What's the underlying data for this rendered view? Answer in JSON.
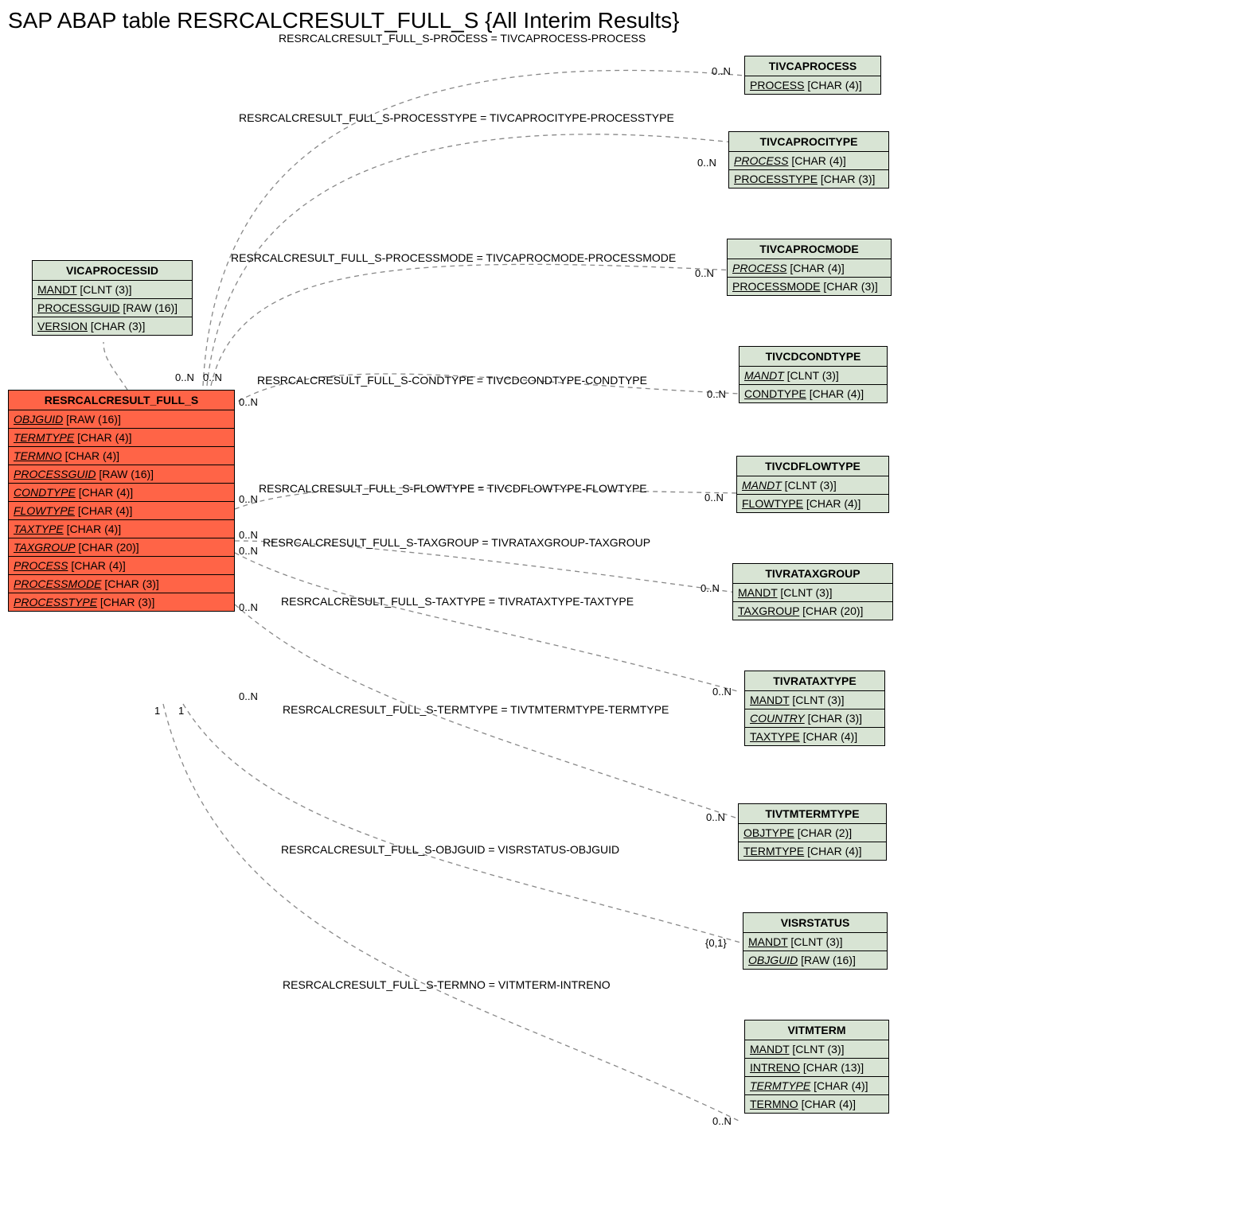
{
  "title": "SAP ABAP table RESRCALCRESULT_FULL_S {All Interim Results}",
  "entities": {
    "vicaprocessid": {
      "name": "VICAPROCESSID",
      "fields": [
        {
          "name": "MANDT",
          "type": "[CLNT (3)]",
          "italic": false
        },
        {
          "name": "PROCESSGUID",
          "type": "[RAW (16)]",
          "italic": false
        },
        {
          "name": "VERSION",
          "type": "[CHAR (3)]",
          "italic": false
        }
      ]
    },
    "main": {
      "name": "RESRCALCRESULT_FULL_S",
      "fields": [
        {
          "name": "OBJGUID",
          "type": "[RAW (16)]",
          "italic": true
        },
        {
          "name": "TERMTYPE",
          "type": "[CHAR (4)]",
          "italic": true
        },
        {
          "name": "TERMNO",
          "type": "[CHAR (4)]",
          "italic": true
        },
        {
          "name": "PROCESSGUID",
          "type": "[RAW (16)]",
          "italic": true
        },
        {
          "name": "CONDTYPE",
          "type": "[CHAR (4)]",
          "italic": true
        },
        {
          "name": "FLOWTYPE",
          "type": "[CHAR (4)]",
          "italic": true
        },
        {
          "name": "TAXTYPE",
          "type": "[CHAR (4)]",
          "italic": true
        },
        {
          "name": "TAXGROUP",
          "type": "[CHAR (20)]",
          "italic": true
        },
        {
          "name": "PROCESS",
          "type": "[CHAR (4)]",
          "italic": true
        },
        {
          "name": "PROCESSMODE",
          "type": "[CHAR (3)]",
          "italic": true
        },
        {
          "name": "PROCESSTYPE",
          "type": "[CHAR (3)]",
          "italic": true
        }
      ]
    },
    "tivcaprocess": {
      "name": "TIVCAPROCESS",
      "fields": [
        {
          "name": "PROCESS",
          "type": "[CHAR (4)]",
          "italic": false
        }
      ]
    },
    "tivcaprocitype": {
      "name": "TIVCAPROCITYPE",
      "fields": [
        {
          "name": "PROCESS",
          "type": "[CHAR (4)]",
          "italic": true
        },
        {
          "name": "PROCESSTYPE",
          "type": "[CHAR (3)]",
          "italic": false
        }
      ]
    },
    "tivcaprocmode": {
      "name": "TIVCAPROCMODE",
      "fields": [
        {
          "name": "PROCESS",
          "type": "[CHAR (4)]",
          "italic": true
        },
        {
          "name": "PROCESSMODE",
          "type": "[CHAR (3)]",
          "italic": false
        }
      ]
    },
    "tivcdcondtype": {
      "name": "TIVCDCONDTYPE",
      "fields": [
        {
          "name": "MANDT",
          "type": "[CLNT (3)]",
          "italic": true
        },
        {
          "name": "CONDTYPE",
          "type": "[CHAR (4)]",
          "italic": false
        }
      ]
    },
    "tivcdflowtype": {
      "name": "TIVCDFLOWTYPE",
      "fields": [
        {
          "name": "MANDT",
          "type": "[CLNT (3)]",
          "italic": true
        },
        {
          "name": "FLOWTYPE",
          "type": "[CHAR (4)]",
          "italic": false
        }
      ]
    },
    "tivrataxgroup": {
      "name": "TIVRATAXGROUP",
      "fields": [
        {
          "name": "MANDT",
          "type": "[CLNT (3)]",
          "italic": false
        },
        {
          "name": "TAXGROUP",
          "type": "[CHAR (20)]",
          "italic": false
        }
      ]
    },
    "tivrataxtype": {
      "name": "TIVRATAXTYPE",
      "fields": [
        {
          "name": "MANDT",
          "type": "[CLNT (3)]",
          "italic": false
        },
        {
          "name": "COUNTRY",
          "type": "[CHAR (3)]",
          "italic": true
        },
        {
          "name": "TAXTYPE",
          "type": "[CHAR (4)]",
          "italic": false
        }
      ]
    },
    "tivtmtermtype": {
      "name": "TIVTMTERMTYPE",
      "fields": [
        {
          "name": "OBJTYPE",
          "type": "[CHAR (2)]",
          "italic": false
        },
        {
          "name": "TERMTYPE",
          "type": "[CHAR (4)]",
          "italic": false
        }
      ]
    },
    "visrstatus": {
      "name": "VISRSTATUS",
      "fields": [
        {
          "name": "MANDT",
          "type": "[CLNT (3)]",
          "italic": false
        },
        {
          "name": "OBJGUID",
          "type": "[RAW (16)]",
          "italic": true
        }
      ]
    },
    "vitmterm": {
      "name": "VITMTERM",
      "fields": [
        {
          "name": "MANDT",
          "type": "[CLNT (3)]",
          "italic": false
        },
        {
          "name": "INTRENO",
          "type": "[CHAR (13)]",
          "italic": false
        },
        {
          "name": "TERMTYPE",
          "type": "[CHAR (4)]",
          "italic": true
        },
        {
          "name": "TERMNO",
          "type": "[CHAR (4)]",
          "italic": false
        }
      ]
    }
  },
  "relations": {
    "r1": "RESRCALCRESULT_FULL_S-PROCESS = TIVCAPROCESS-PROCESS",
    "r2": "RESRCALCRESULT_FULL_S-PROCESSTYPE = TIVCAPROCITYPE-PROCESSTYPE",
    "r3": "RESRCALCRESULT_FULL_S-PROCESSMODE = TIVCAPROCMODE-PROCESSMODE",
    "r4": "RESRCALCRESULT_FULL_S-CONDTYPE = TIVCDCONDTYPE-CONDTYPE",
    "r5": "RESRCALCRESULT_FULL_S-FLOWTYPE = TIVCDFLOWTYPE-FLOWTYPE",
    "r6": "RESRCALCRESULT_FULL_S-TAXGROUP = TIVRATAXGROUP-TAXGROUP",
    "r7": "RESRCALCRESULT_FULL_S-TAXTYPE = TIVRATAXTYPE-TAXTYPE",
    "r8": "RESRCALCRESULT_FULL_S-TERMTYPE = TIVTMTERMTYPE-TERMTYPE",
    "r9": "RESRCALCRESULT_FULL_S-OBJGUID = VISRSTATUS-OBJGUID",
    "r10": "RESRCALCRESULT_FULL_S-TERMNO = VITMTERM-INTRENO"
  },
  "cards": {
    "zero_n": "0..N",
    "zero_one": "{0,1}",
    "one": "1"
  }
}
